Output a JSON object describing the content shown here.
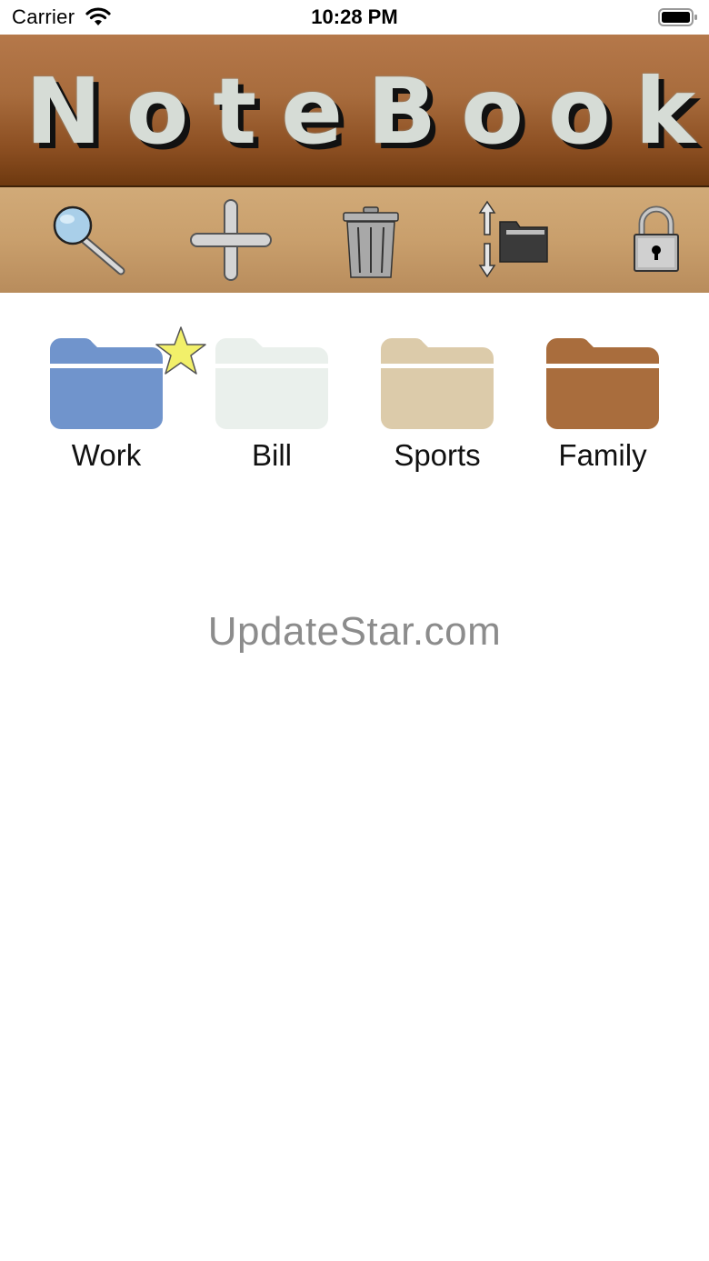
{
  "status_bar": {
    "carrier": "Carrier",
    "time": "10:28 PM"
  },
  "header": {
    "title": "NoteBook"
  },
  "toolbar": {
    "icons": [
      "search-icon",
      "add-icon",
      "trash-icon",
      "sort-folders-icon",
      "lock-icon"
    ]
  },
  "folders": [
    {
      "label": "Work",
      "color": "#7094cc",
      "starred": true
    },
    {
      "label": "Bill",
      "color": "#eaf0ec",
      "starred": false
    },
    {
      "label": "Sports",
      "color": "#dccbaa",
      "starred": false
    },
    {
      "label": "Family",
      "color": "#a96d3d",
      "starred": false
    }
  ],
  "watermark": "UpdateStar.com",
  "colors": {
    "banner": "#a86c3d",
    "toolbar": "#c99f6c",
    "title_text": "#d6dcd6"
  }
}
